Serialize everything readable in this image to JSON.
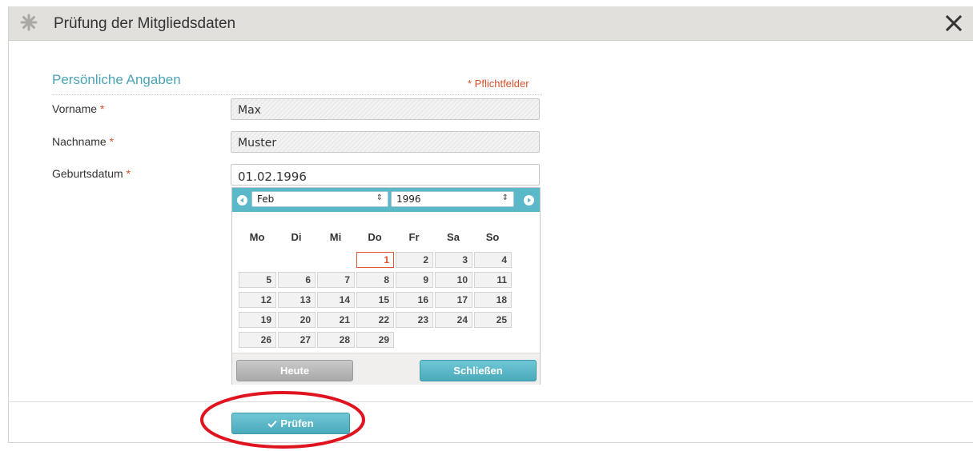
{
  "dialog": {
    "title": "Prüfung der Mitgliedsdaten",
    "icon": "asterisk-icon",
    "close_icon": "close-icon"
  },
  "section": {
    "title": "Persönliche Angaben",
    "required_note": "* Pflichtfelder"
  },
  "fields": {
    "firstname": {
      "label": "Vorname",
      "required_mark": "*",
      "value": "Max"
    },
    "lastname": {
      "label": "Nachname",
      "required_mark": "*",
      "value": "Muster"
    },
    "birthdate": {
      "label": "Geburtsdatum",
      "required_mark": "*",
      "value": "01.02.1996"
    }
  },
  "calendar": {
    "month": "Feb",
    "year": "1996",
    "select_arrow": "⇕",
    "weekdays": [
      "Mo",
      "Di",
      "Mi",
      "Do",
      "Fr",
      "Sa",
      "So"
    ],
    "days": [
      "1",
      "2",
      "3",
      "4",
      "5",
      "6",
      "7",
      "8",
      "9",
      "10",
      "11",
      "12",
      "13",
      "14",
      "15",
      "16",
      "17",
      "18",
      "19",
      "20",
      "21",
      "22",
      "23",
      "24",
      "25",
      "26",
      "27",
      "28",
      "29"
    ],
    "first_weekday_index": 3,
    "selected_day": "1",
    "today_label": "Heute",
    "close_label": "Schließen"
  },
  "submit": {
    "label": "Prüfen",
    "icon": "checkmark-icon"
  },
  "colors": {
    "accent": "#4aa3b5",
    "required": "#d9502a",
    "highlight_circle": "#e0141e"
  }
}
